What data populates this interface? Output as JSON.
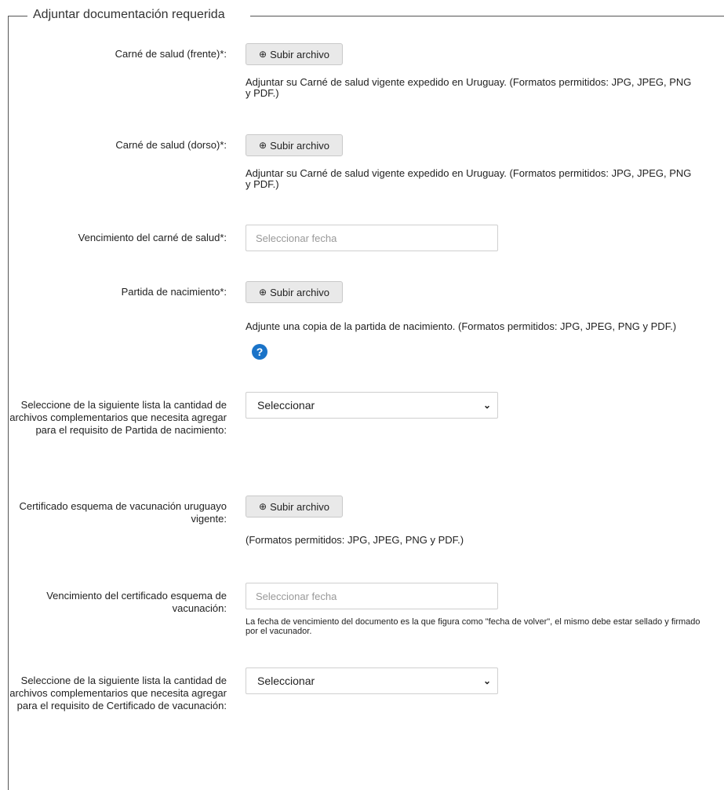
{
  "section_title": "Adjuntar documentación requerida",
  "upload_button_label": "Subir archivo",
  "upload_icon": "circle-arrow-up-icon",
  "fields": {
    "carne_frente": {
      "label": "Carné de salud (frente)*:",
      "help": "Adjuntar su Carné de salud vigente expedido en Uruguay. (Formatos permitidos: JPG, JPEG, PNG y PDF.)"
    },
    "carne_dorso": {
      "label": "Carné de salud (dorso)*:",
      "help": "Adjuntar su Carné de salud vigente expedido en Uruguay. (Formatos permitidos: JPG, JPEG, PNG y PDF.)"
    },
    "vencimiento_carne": {
      "label": "Vencimiento del carné de salud*:",
      "placeholder": "Seleccionar fecha"
    },
    "partida_nacimiento": {
      "label": "Partida de nacimiento*:",
      "help": "Adjunte una copia de la partida de nacimiento. (Formatos permitidos: JPG, JPEG, PNG y PDF.)",
      "help_icon": "?"
    },
    "complementarios_partida": {
      "label": "Seleccione de la siguiente lista la cantidad de archivos complementarios que necesita agregar para el requisito de Partida de nacimiento:",
      "selected": "Seleccionar"
    },
    "certificado_vacunacion": {
      "label": "Certificado esquema de vacunación uruguayo vigente:",
      "help": "(Formatos permitidos: JPG, JPEG, PNG y PDF.)"
    },
    "vencimiento_certificado": {
      "label": "Vencimiento del certificado esquema de vacunación:",
      "placeholder": "Seleccionar fecha",
      "help": "La fecha de vencimiento del documento es la que figura como \"fecha de volver\", el mismo debe estar sellado y firmado por el vacunador."
    },
    "complementarios_certificado": {
      "label": "Seleccione de la siguiente lista la cantidad de archivos complementarios que necesita agregar para el requisito de Certificado de vacunación:",
      "selected": "Seleccionar"
    }
  },
  "colors": {
    "help_icon": "#1a73c8",
    "button_bg": "#e9e9e9"
  }
}
